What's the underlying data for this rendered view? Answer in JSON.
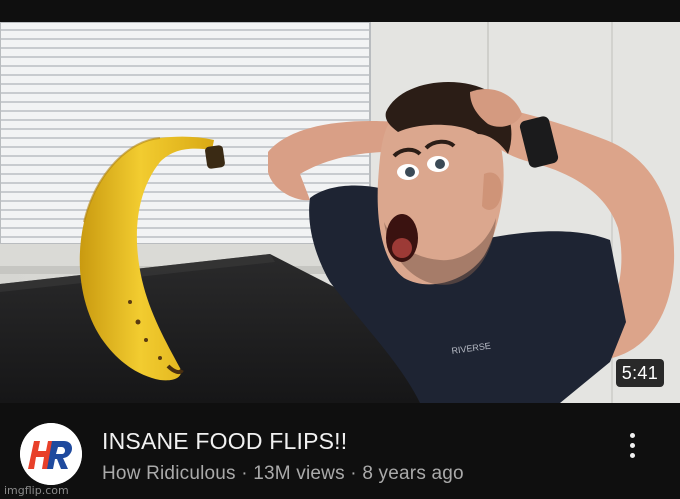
{
  "video": {
    "duration": "5:41",
    "title": "INSANE FOOD FLIPS!!",
    "channel": "How Ridiculous",
    "views": "13M views",
    "age": "8 years ago",
    "separator": "·",
    "shirt_text": "RIVERSE"
  },
  "channel_avatar": {
    "logo_text": "HR",
    "logo_colors": {
      "primary": "#e8402a",
      "secondary": "#1f4a9e",
      "background": "#ffffff"
    }
  },
  "icons": {
    "more": "more-vertical-icon"
  },
  "watermark": "imgflip.com"
}
